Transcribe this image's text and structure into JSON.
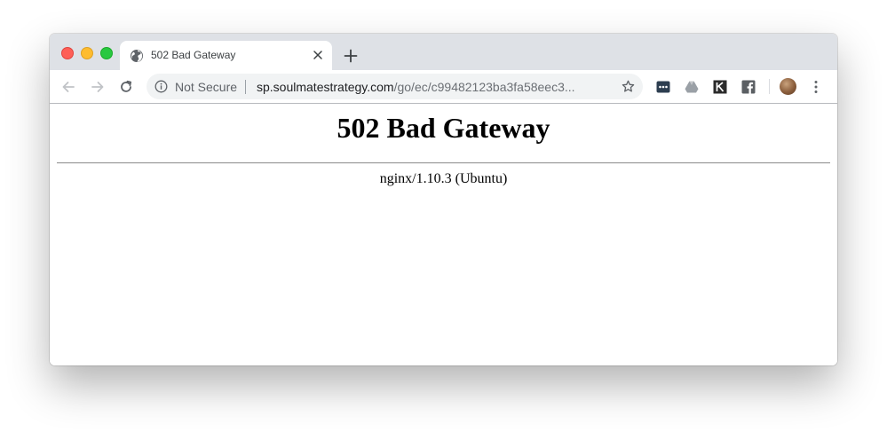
{
  "tab": {
    "title": "502 Bad Gateway"
  },
  "omnibox": {
    "security_label": "Not Secure",
    "url_host": "sp.soulmatestrategy.com",
    "url_path": "/go/ec/c99482123ba3fa58eec3..."
  },
  "toolbar": {
    "icons": [
      "back-icon",
      "forward-icon",
      "reload-icon",
      "info-icon",
      "star-icon"
    ],
    "extensions": [
      "ellipsis-extension-icon",
      "google-drive-icon",
      "kindle-icon",
      "facebook-icon"
    ]
  },
  "page": {
    "heading": "502 Bad Gateway",
    "server": "nginx/1.10.3 (Ubuntu)"
  },
  "colors": {
    "tabstrip": "#dee1e6",
    "omnibox": "#f1f3f4",
    "close_light": "#fe5f57",
    "minimize_light": "#febc2e",
    "zoom_light": "#28c840"
  }
}
